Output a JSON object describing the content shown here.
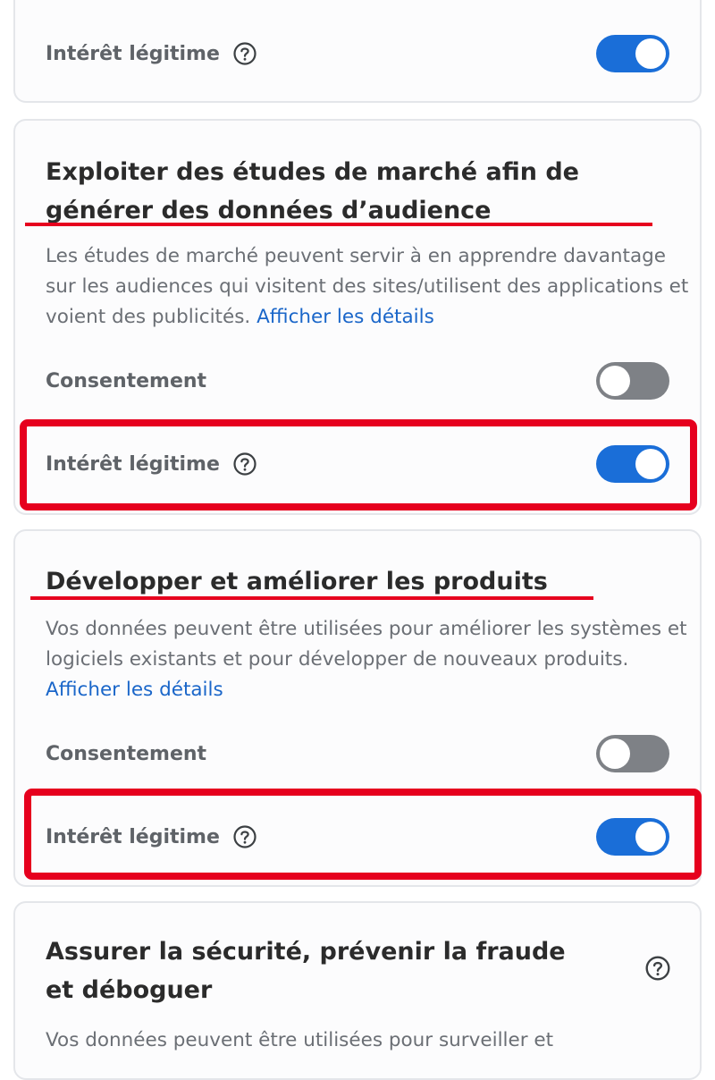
{
  "purposes": [
    {
      "legitimate_interest": {
        "label": "Intérêt légitime",
        "on": true
      }
    },
    {
      "title": "Exploiter des études de marché afin de générer des données d’audience",
      "description": "Les études de marché peuvent servir à en apprendre davantage sur les audiences qui visitent des sites/utilisent des applications et voient des publicités.",
      "details_link": "Afficher les détails",
      "consent": {
        "label": "Consentement",
        "on": false
      },
      "legitimate_interest": {
        "label": "Intérêt légitime",
        "on": true
      }
    },
    {
      "title": "Développer et améliorer les produits",
      "description": "Vos données peuvent être utilisées pour améliorer les systèmes et logiciels existants et pour développer de nouveaux produits.",
      "details_link": "Afficher les détails",
      "consent": {
        "label": "Consentement",
        "on": false
      },
      "legitimate_interest": {
        "label": "Intérêt légitime",
        "on": true
      }
    },
    {
      "title": "Assurer la sécurité, prévenir la fraude et déboguer",
      "description": "Vos données peuvent être utilisées pour surveiller et"
    }
  ],
  "annotations": {
    "color": "#e6001e"
  },
  "colors": {
    "toggle_on": "#1a6ed8",
    "toggle_off": "#7e8186",
    "link": "#1a66c9"
  },
  "icons": {
    "help": "question-circle-icon"
  }
}
